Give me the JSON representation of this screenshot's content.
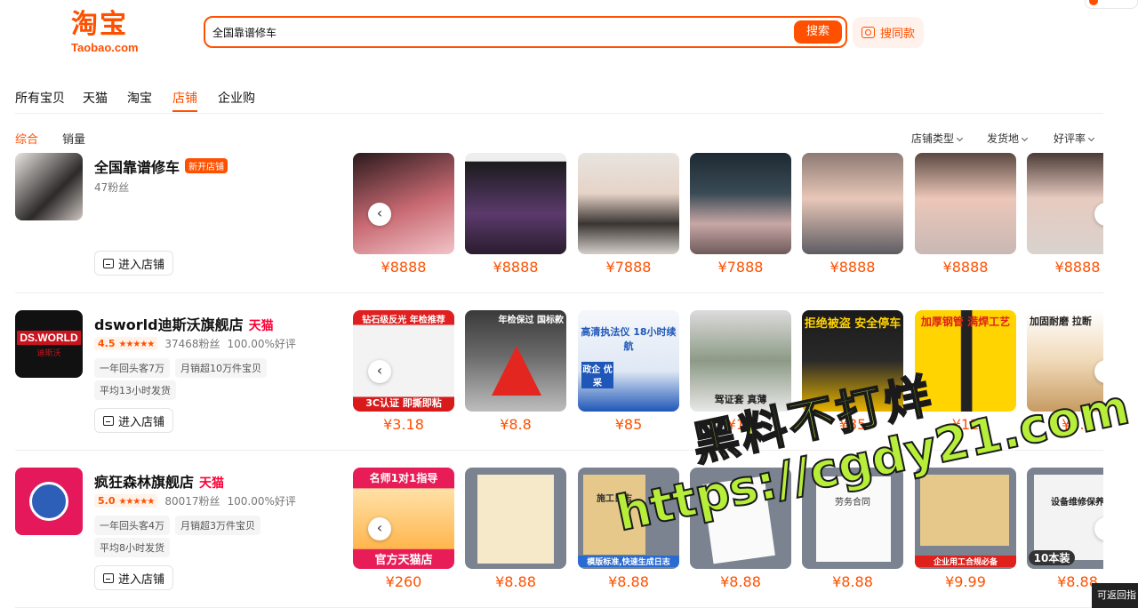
{
  "header": {
    "logo_text": "淘宝",
    "logo_sub": "Taobao.com",
    "search_value": "全国靠谱修车",
    "search_button": "搜索",
    "same_style_button": "搜同款"
  },
  "tabs": [
    {
      "label": "所有宝贝",
      "active": false
    },
    {
      "label": "天猫",
      "active": false
    },
    {
      "label": "淘宝",
      "active": false
    },
    {
      "label": "店铺",
      "active": true
    },
    {
      "label": "企业购",
      "active": false
    }
  ],
  "sort": {
    "comprehensive": "综合",
    "sales": "销量"
  },
  "filters": {
    "shop_type": "店铺类型",
    "ship_from": "发货地",
    "rating": "好评率"
  },
  "shops": [
    {
      "name": "全国靠谱修车",
      "tag": "新开店铺",
      "fans": "47粉丝",
      "enter": "进入店铺",
      "items": [
        "¥8888",
        "¥8888",
        "¥7888",
        "¥7888",
        "¥8888",
        "¥8888",
        "¥8888"
      ]
    },
    {
      "name": "dsworld迪斯沃旗舰店",
      "tmall": "天猫",
      "score": "4.5",
      "fans": "37468粉丝",
      "good_rate": "100.00%好评",
      "chips": [
        "一年回头客7万",
        "月销超10万件宝贝"
      ],
      "ship": "平均13小时发货",
      "enter": "进入店铺",
      "logo_text": "DS.WORLD",
      "logo_sub": "迪斯沃",
      "items": [
        "¥3.18",
        "¥8.8",
        "¥85",
        "¥15",
        "¥85",
        "¥12",
        "¥8.4"
      ],
      "item_texts": [
        "钻石级反光 年检推荐",
        "年检保过 国标款",
        "高清执法仪 18小时续航",
        "驾证套 真薄",
        "拒绝被盗 安全停车",
        "加厚钢管 满焊工艺",
        "加固耐磨 拉断"
      ],
      "item_bottoms": [
        "3C认证 即撕即粘",
        "",
        "政企 优采",
        "",
        "",
        "",
        ""
      ]
    },
    {
      "name": "疯狂森林旗舰店",
      "tmall": "天猫",
      "score": "5.0",
      "fans": "80017粉丝",
      "good_rate": "100.00%好评",
      "chips": [
        "一年回头客4万",
        "月销超3万件宝贝"
      ],
      "ship": "平均8小时发货",
      "enter": "进入店铺",
      "items": [
        "¥260",
        "¥8.88",
        "¥8.88",
        "¥8.88",
        "¥8.88",
        "¥9.99",
        "¥8.88"
      ],
      "item_texts": [
        "名师1对1指导",
        "",
        "施工日志",
        "",
        "劳务合同",
        "",
        "设备维修保养"
      ],
      "item_bottoms": [
        "官方天猫店",
        "",
        "模版标准,快速生成日志",
        "",
        "",
        "企业用工合规必备",
        "10本装"
      ]
    }
  ],
  "watermark": {
    "line1": "黑料不打烊",
    "line2": "https://cgdy21.com"
  },
  "corner_label": "可返回指",
  "colors": {
    "accent": "#ff5000",
    "tmall": "#ff0036"
  }
}
